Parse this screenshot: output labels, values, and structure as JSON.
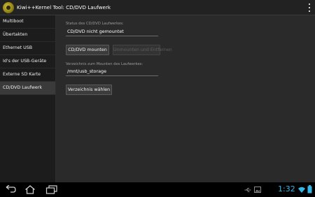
{
  "app": {
    "title": "Kiwi++Kernel Tool: CD/DVD Laufwerk"
  },
  "sidebar": {
    "items": [
      {
        "label": "Multiboot"
      },
      {
        "label": "Übertakten"
      },
      {
        "label": "Ethernet USB"
      },
      {
        "label": "Id's der USB-Geräte"
      },
      {
        "label": "Externe SD Karte"
      },
      {
        "label": "CD/DVD Laufwerk"
      }
    ],
    "selected_index": 5
  },
  "main": {
    "status_label": "Status des CD/DVD Laufwerkes:",
    "status_value": "CD/DVD nicht gemountet",
    "mount_button": "CD/DVD mounten",
    "unmount_button": "Unmounten und Entfernen",
    "dir_label": "Verzeichnis zum Mounten des Laufwerkes:",
    "dir_value": "/mnt/usb_storage",
    "choose_button": "Verzeichnis wählen"
  },
  "statusbar": {
    "time": "1:32"
  },
  "colors": {
    "accent": "#33b5e5",
    "background": "#2a2a2a",
    "sidebar_selected": "#3a3a3a"
  },
  "icons": {
    "back": "back-icon",
    "home": "home-icon",
    "recents": "recents-icon",
    "overflow": "overflow-menu-icon",
    "usb": "usb-icon",
    "picture": "picture-icon",
    "wifi": "wifi-icon",
    "battery": "battery-icon"
  }
}
